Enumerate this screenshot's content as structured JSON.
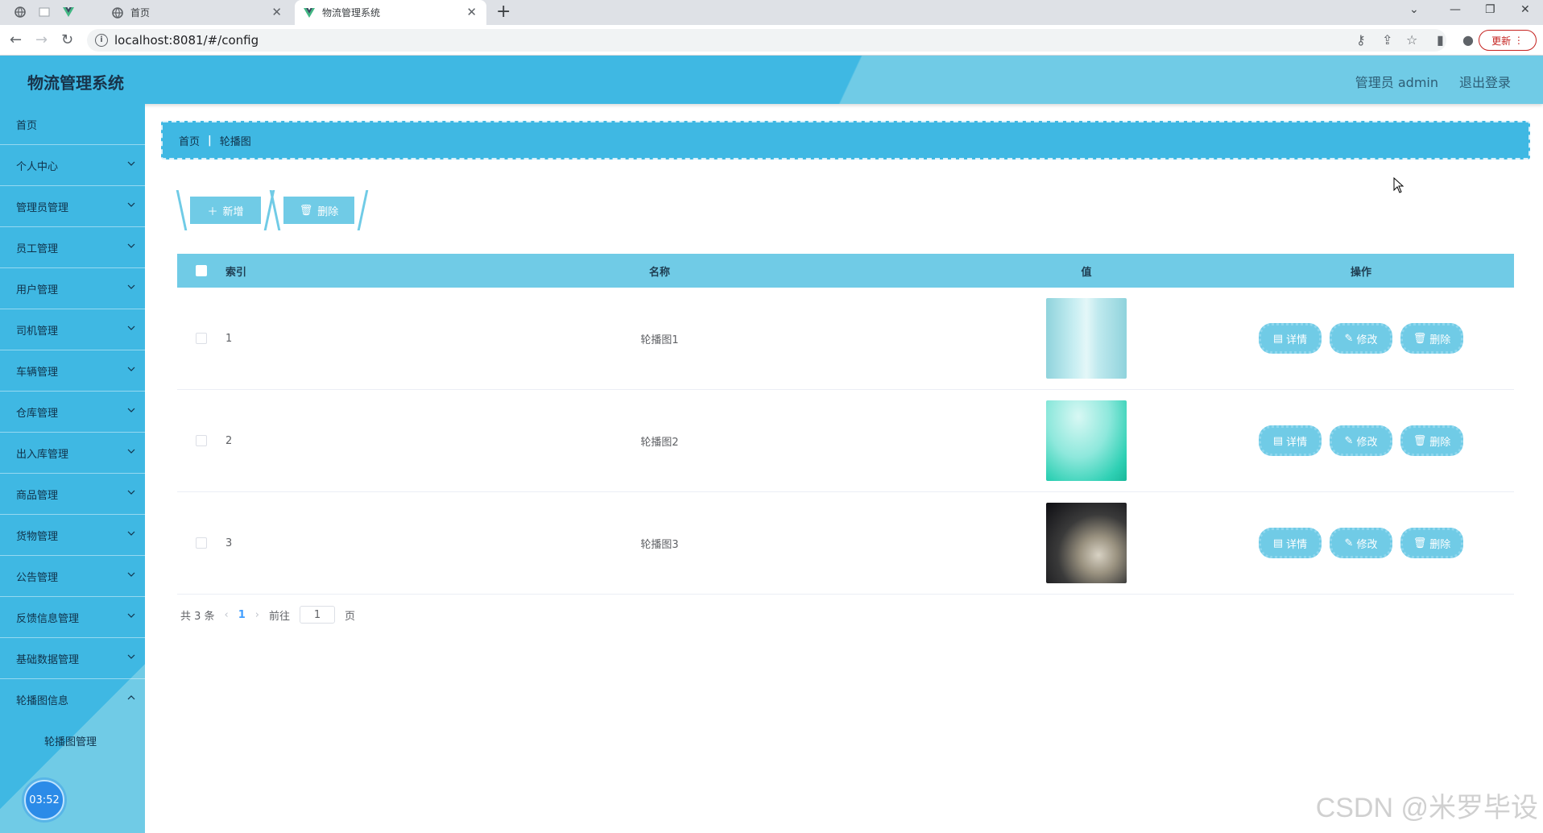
{
  "browser": {
    "tabs": [
      {
        "label": "首页",
        "active": false
      },
      {
        "label": "物流管理系统",
        "active": true
      }
    ],
    "url": "localhost:8081/#/config",
    "update_label": "更新"
  },
  "header": {
    "title": "物流管理系统",
    "user": "管理员 admin",
    "logout": "退出登录"
  },
  "sidebar": {
    "items": [
      {
        "label": "首页"
      },
      {
        "label": "个人中心"
      },
      {
        "label": "管理员管理"
      },
      {
        "label": "员工管理"
      },
      {
        "label": "用户管理"
      },
      {
        "label": "司机管理"
      },
      {
        "label": "车辆管理"
      },
      {
        "label": "仓库管理"
      },
      {
        "label": "出入库管理"
      },
      {
        "label": "商品管理"
      },
      {
        "label": "货物管理"
      },
      {
        "label": "公告管理"
      },
      {
        "label": "反馈信息管理"
      },
      {
        "label": "基础数据管理"
      },
      {
        "label": "轮播图信息"
      }
    ],
    "submenu": {
      "label": "轮播图管理"
    },
    "clock": "03:52"
  },
  "breadcrumb": {
    "home": "首页",
    "current": "轮播图"
  },
  "actions": {
    "add": "新增",
    "delete": "删除"
  },
  "table": {
    "headers": {
      "index": "索引",
      "name": "名称",
      "value": "值",
      "ops": "操作"
    },
    "rows": [
      {
        "index": "1",
        "name": "轮播图1"
      },
      {
        "index": "2",
        "name": "轮播图2"
      },
      {
        "index": "3",
        "name": "轮播图3"
      }
    ],
    "op_labels": {
      "detail": "详情",
      "edit": "修改",
      "delete": "删除"
    }
  },
  "pagination": {
    "total": "共 3 条",
    "current": "1",
    "goto": "前往",
    "page_value": "1",
    "page_suffix": "页"
  },
  "watermark": "CSDN @米罗毕设",
  "colors": {
    "primary": "#3fb8e3",
    "light": "#70cbe6",
    "accent": "#409eff"
  }
}
